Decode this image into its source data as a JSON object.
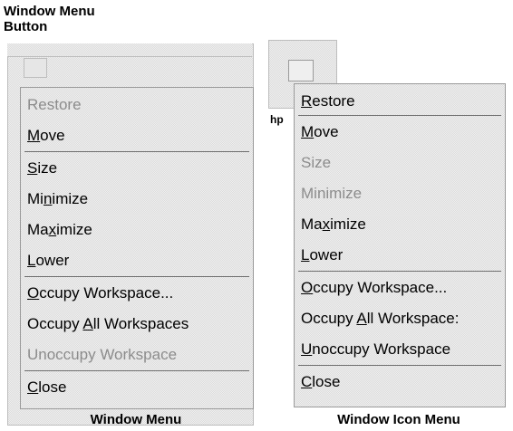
{
  "callout_label": "Window Menu\nButton",
  "window_menu": {
    "caption": "Window Menu",
    "items": [
      {
        "label": "Restore"
      },
      {
        "label": "Move"
      },
      {
        "label": "Size"
      },
      {
        "label": "Minimize"
      },
      {
        "label": "Maximize"
      },
      {
        "label": "Lower"
      },
      {
        "label": "Occupy Workspace..."
      },
      {
        "label": "Occupy All Workspaces"
      },
      {
        "label": "Unoccupy Workspace"
      },
      {
        "label": "Close"
      }
    ]
  },
  "icon_menu": {
    "caption": "Window Icon Menu",
    "icon_label": "hp",
    "items": [
      {
        "label": "Restore"
      },
      {
        "label": "Move"
      },
      {
        "label": "Size"
      },
      {
        "label": "Minimize"
      },
      {
        "label": "Maximize"
      },
      {
        "label": "Lower"
      },
      {
        "label": "Occupy Workspace..."
      },
      {
        "label": "Occupy All Workspace:"
      },
      {
        "label": "Unoccupy Workspace"
      },
      {
        "label": "Close"
      }
    ]
  }
}
